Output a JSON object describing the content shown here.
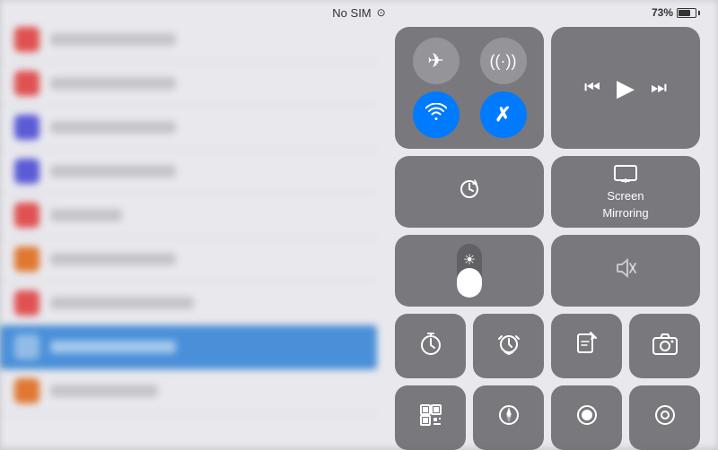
{
  "statusBar": {
    "carrier": "No SIM",
    "wifi": "📶",
    "battery": "73%"
  },
  "connectivity": {
    "airplane": {
      "icon": "✈",
      "active": false
    },
    "cellular": {
      "icon": "📡",
      "active": false
    },
    "wifi": {
      "icon": "📶",
      "active": true
    },
    "bluetooth": {
      "icon": "✦",
      "active": true
    }
  },
  "media": {
    "prev": "⏮",
    "play": "▶",
    "next": "⏭"
  },
  "row2": {
    "orientation": {
      "icon": "🔒"
    },
    "screenMirroring": {
      "icon": "📺",
      "line1": "Screen",
      "line2": "Mirroring"
    },
    "brightness": {
      "icon": "☀",
      "fillPercent": 55
    },
    "mute": {
      "icon": "🔇"
    }
  },
  "row3": [
    {
      "id": "timer",
      "icon": "⏱"
    },
    {
      "id": "alarm",
      "icon": "⏰"
    },
    {
      "id": "notepad",
      "icon": "📝"
    },
    {
      "id": "camera",
      "icon": "📷"
    }
  ],
  "row4": [
    {
      "id": "qr",
      "icon": "⬛"
    },
    {
      "id": "compass",
      "icon": "✦"
    },
    {
      "id": "record",
      "icon": "⏺"
    },
    {
      "id": "extra",
      "icon": "⬜"
    }
  ],
  "bgItems": [
    {
      "color": "#e05252"
    },
    {
      "color": "#e05252"
    },
    {
      "color": "#5b5bd6"
    },
    {
      "color": "#5b5bd6"
    },
    {
      "color": "#e05252"
    },
    {
      "color": "#e07832"
    },
    {
      "color": "#e05252"
    },
    {
      "color": "#4a90d9",
      "selected": true
    },
    {
      "color": "#e07832"
    }
  ]
}
